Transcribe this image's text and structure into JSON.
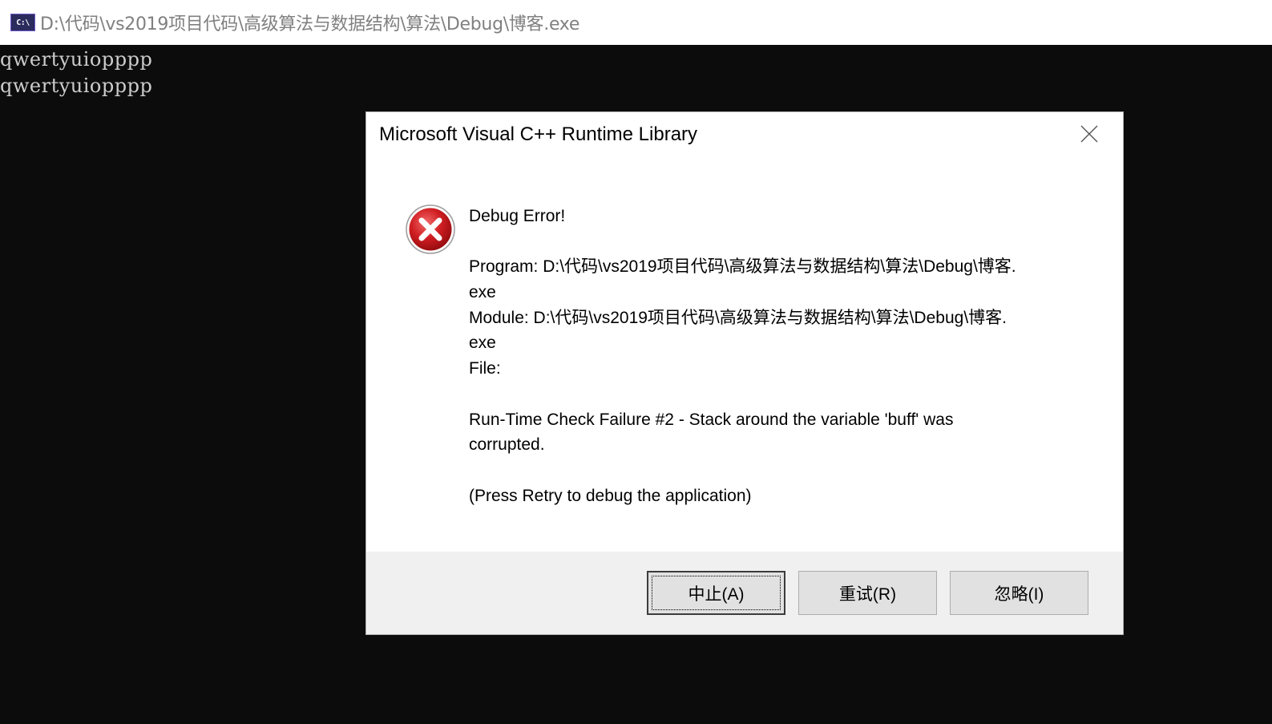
{
  "window": {
    "icon_text": "C:\\",
    "title": "D:\\代码\\vs2019项目代码\\高级算法与数据结构\\算法\\Debug\\博客.exe"
  },
  "console": {
    "lines": [
      "qwertyuiopppp",
      "qwertyuiopppp"
    ]
  },
  "dialog": {
    "title": "Microsoft Visual C++ Runtime Library",
    "icon": "error-icon",
    "message_lines": [
      "Debug Error!",
      "",
      "Program: D:\\代码\\vs2019项目代码\\高级算法与数据结构\\算法\\Debug\\博客.",
      "exe",
      "Module: D:\\代码\\vs2019项目代码\\高级算法与数据结构\\算法\\Debug\\博客.",
      "exe",
      "File:",
      "",
      "Run-Time Check Failure #2 - Stack around the variable 'buff' was",
      "corrupted.",
      "",
      "(Press Retry to debug the application)"
    ],
    "buttons": {
      "abort": "中止(A)",
      "retry": "重试(R)",
      "ignore": "忽略(I)"
    }
  },
  "colors": {
    "console_bg": "#0c0c0c",
    "console_text": "#cccccc",
    "error_red": "#c4161c",
    "button_bar": "#f0f0f0"
  }
}
